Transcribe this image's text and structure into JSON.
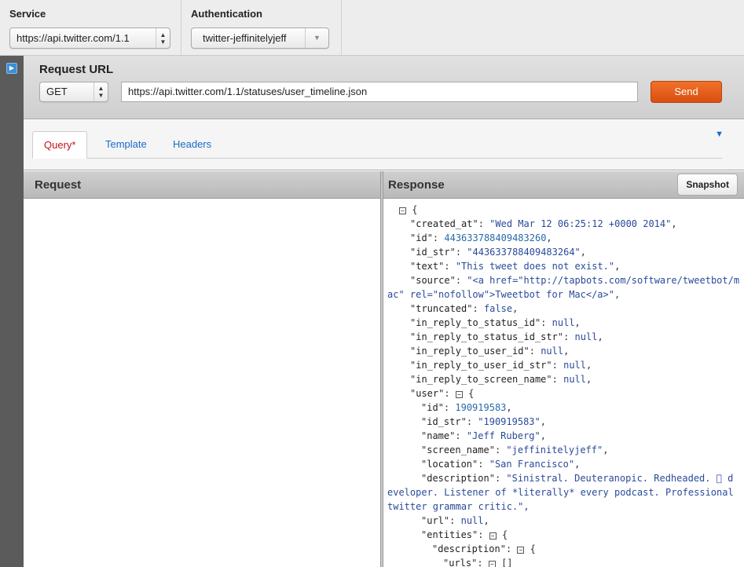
{
  "service": {
    "label": "Service",
    "value": "https://api.twitter.com/1.1"
  },
  "authentication": {
    "label": "Authentication",
    "value": "twitter-jeffinitelyjeff"
  },
  "request_url": {
    "title": "Request URL",
    "method": "GET",
    "url": "https://api.twitter.com/1.1/statuses/user_timeline.json",
    "send_label": "Send"
  },
  "tabs": [
    {
      "label": "Query",
      "marker": "*",
      "active": true
    },
    {
      "label": "Template",
      "active": false
    },
    {
      "label": "Headers",
      "active": false
    }
  ],
  "request_pane": {
    "title": "Request"
  },
  "response_pane": {
    "title": "Response",
    "snapshot_label": "Snapshot"
  },
  "response_json": [
    {
      "indent": 1,
      "fold": true,
      "text": "{"
    },
    {
      "indent": 2,
      "key": "created_at",
      "value": "\"Wed Mar 12 06:25:12 +0000 2014\"",
      "type": "s",
      "comma": true
    },
    {
      "indent": 2,
      "key": "id",
      "value": "443633788409483260",
      "type": "n",
      "comma": true
    },
    {
      "indent": 2,
      "key": "id_str",
      "value": "\"443633788409483264\"",
      "type": "s",
      "comma": true
    },
    {
      "indent": 2,
      "key": "text",
      "value": "\"This tweet does not exist.\"",
      "type": "s",
      "comma": true
    },
    {
      "indent": 2,
      "key": "source",
      "value": "\"<a href=\"http://tapbots.com/software/tweetbot/m",
      "type": "s",
      "comma": false
    },
    {
      "indent": 0,
      "raw": "ac\" rel=\"nofollow\">Tweetbot for Mac</a>\","
    },
    {
      "indent": 2,
      "key": "truncated",
      "value": "false",
      "type": "kw",
      "comma": true
    },
    {
      "indent": 2,
      "key": "in_reply_to_status_id",
      "value": "null",
      "type": "kw",
      "comma": true
    },
    {
      "indent": 2,
      "key": "in_reply_to_status_id_str",
      "value": "null",
      "type": "kw",
      "comma": true
    },
    {
      "indent": 2,
      "key": "in_reply_to_user_id",
      "value": "null",
      "type": "kw",
      "comma": true
    },
    {
      "indent": 2,
      "key": "in_reply_to_user_id_str",
      "value": "null",
      "type": "kw",
      "comma": true
    },
    {
      "indent": 2,
      "key": "in_reply_to_screen_name",
      "value": "null",
      "type": "kw",
      "comma": true
    },
    {
      "indent": 2,
      "key": "user",
      "fold": true,
      "value": "{",
      "type": "p",
      "comma": false
    },
    {
      "indent": 3,
      "key": "id",
      "value": "190919583",
      "type": "n",
      "comma": true
    },
    {
      "indent": 3,
      "key": "id_str",
      "value": "\"190919583\"",
      "type": "s",
      "comma": true
    },
    {
      "indent": 3,
      "key": "name",
      "value": "\"Jeff Ruberg\"",
      "type": "s",
      "comma": true
    },
    {
      "indent": 3,
      "key": "screen_name",
      "value": "\"jeffinitelyjeff\"",
      "type": "s",
      "comma": true
    },
    {
      "indent": 3,
      "key": "location",
      "value": "\"San Francisco\"",
      "type": "s",
      "comma": true
    },
    {
      "indent": 3,
      "key": "description",
      "value": "\"Sinistral. Deuteranopic. Redheaded.  d",
      "type": "s",
      "comma": false
    },
    {
      "indent": 0,
      "raw": "eveloper. Listener of *literally* every podcast. Professional"
    },
    {
      "indent": 0,
      "raw": "twitter grammar critic.\","
    },
    {
      "indent": 3,
      "key": "url",
      "value": "null",
      "type": "kw",
      "comma": true
    },
    {
      "indent": 3,
      "key": "entities",
      "fold": true,
      "value": "{",
      "type": "p",
      "comma": false
    },
    {
      "indent": 4,
      "key": "description",
      "fold": true,
      "value": "{",
      "type": "p",
      "comma": false
    },
    {
      "indent": 5,
      "key": "urls",
      "fold": true,
      "value": "[]",
      "type": "p",
      "comma": false
    }
  ]
}
